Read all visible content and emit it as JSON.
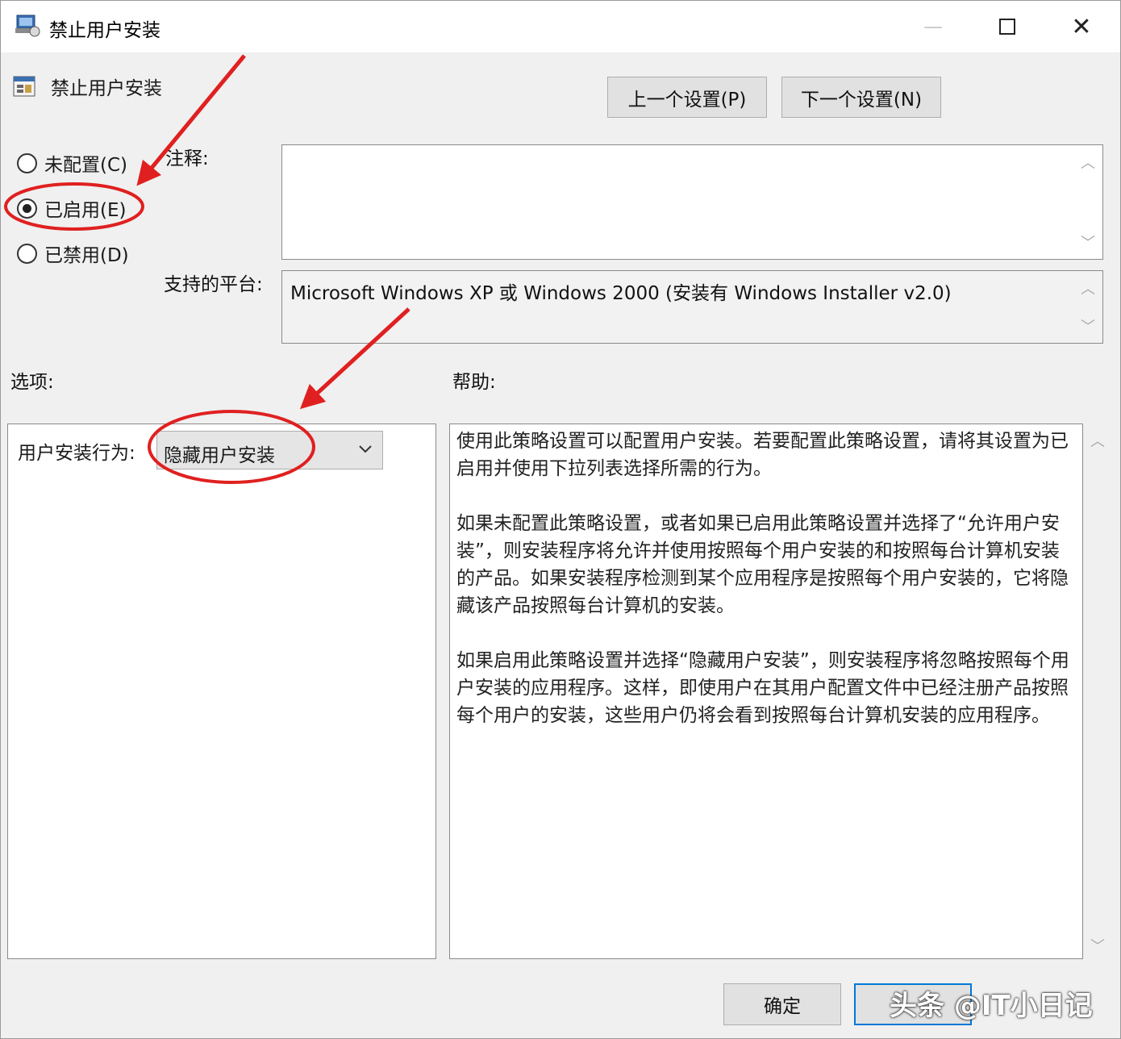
{
  "window": {
    "title": "禁止用户安装",
    "policy_name": "禁止用户安装"
  },
  "nav": {
    "prev_label": "上一个设置(P)",
    "next_label": "下一个设置(N)"
  },
  "state": {
    "options": [
      {
        "label": "未配置(C)",
        "checked": false
      },
      {
        "label": "已启用(E)",
        "checked": true
      },
      {
        "label": "已禁用(D)",
        "checked": false
      }
    ]
  },
  "comment": {
    "label": "注释:",
    "value": ""
  },
  "platform": {
    "label": "支持的平台:",
    "value": "Microsoft Windows XP 或 Windows 2000 (安装有 Windows Installer v2.0)"
  },
  "options_section": {
    "label": "选项:",
    "field_label": "用户安装行为:",
    "selected": "隐藏用户安装"
  },
  "help_section": {
    "label": "帮助:",
    "paragraphs": [
      "使用此策略设置可以配置用户安装。若要配置此策略设置，请将其设置为已启用并使用下拉列表选择所需的行为。",
      "如果未配置此策略设置，或者如果已启用此策略设置并选择了“允许用户安装”，则安装程序将允许并使用按照每个用户安装的和按照每台计算机安装的产品。如果安装程序检测到某个应用程序是按照每个用户安装的，它将隐藏该产品按照每台计算机的安装。",
      "如果启用此策略设置并选择“隐藏用户安装”，则安装程序将忽略按照每个用户安装的应用程序。这样，即使用户在其用户配置文件中已经注册产品按照每个用户的安装，这些用户仍将会看到按照每台计算机安装的应用程序。"
    ]
  },
  "footer": {
    "ok_label": "确定",
    "cancel_label": "",
    "watermark": "头条 @IT小日记"
  },
  "colors": {
    "annotation": "#e02020",
    "focus": "#0078d7"
  }
}
